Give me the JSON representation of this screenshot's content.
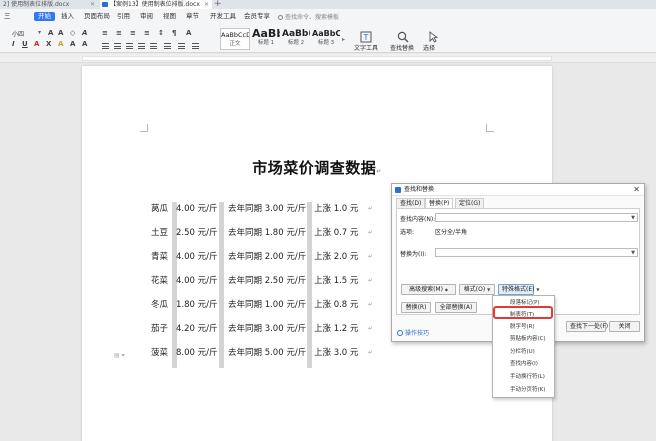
{
  "tabs": [
    {
      "label": "2] 使用制表位排版.docx"
    },
    {
      "label": "【案例13】使用制表位排版.docx"
    }
  ],
  "menu": {
    "items": [
      "三",
      "开始",
      "插入",
      "页面布局",
      "引用",
      "审阅",
      "视图",
      "章节",
      "开发工具",
      "会员专享"
    ],
    "active": "开始",
    "search": "查找命令、搜索模板"
  },
  "ribbon": {
    "font_size": "小四",
    "styles": [
      {
        "sample": "AaBbCcDd",
        "name": "正文"
      },
      {
        "sample": "AaBb",
        "name": "标题 1"
      },
      {
        "sample": "AaBb(",
        "name": "标题 2"
      },
      {
        "sample": "AaBbC",
        "name": "标题 3"
      }
    ],
    "text_tools": "文字工具",
    "find_replace": "查找替换",
    "select": "选择"
  },
  "doc": {
    "title": "市场菜价调查数据",
    "rows": [
      {
        "name": "莴瓜",
        "price": "4.00 元/斤",
        "last": "去年同期 3.00 元/斤",
        "change": "上涨 1.0 元"
      },
      {
        "name": "土豆",
        "price": "2.50 元/斤",
        "last": "去年同期 1.80 元/斤",
        "change": "上涨 0.7 元"
      },
      {
        "name": "青菜",
        "price": "4.00 元/斤",
        "last": "去年同期 2.00 元/斤",
        "change": "上涨 2.0 元"
      },
      {
        "name": "花菜",
        "price": "4.00 元/斤",
        "last": "去年同期 2.50 元/斤",
        "change": "上涨 1.5 元"
      },
      {
        "name": "冬瓜",
        "price": "1.80 元/斤",
        "last": "去年同期 1.00 元/斤",
        "change": "上涨 0.8 元"
      },
      {
        "name": "茄子",
        "price": "4.20 元/斤",
        "last": "去年同期 3.00 元/斤",
        "change": "上涨 1.2 元"
      },
      {
        "name": "菠菜",
        "price": "8.00 元/斤",
        "last": "去年同期 5.00 元/斤",
        "change": "上涨 3.0 元"
      }
    ]
  },
  "dialog": {
    "title": "查找和替换",
    "tabs": [
      "查找(D)",
      "替换(P)",
      "定位(G)"
    ],
    "active_tab": "替换(P)",
    "find_label": "查找内容(N):",
    "find_value": "",
    "options_label": "选项:",
    "options_value": "区分全/半角",
    "replace_label": "替换为(I):",
    "replace_value": "",
    "btn_advanced": "高级搜索(M)",
    "btn_format": "格式(O)",
    "btn_special": "特殊格式(E)",
    "btn_replace": "替换(R)",
    "btn_replace_all": "全部替换(A)",
    "btn_find_next": "查找下一处(F)",
    "btn_close": "关闭",
    "tip": "操作技巧"
  },
  "special_menu": {
    "items": [
      "段落标记(P)",
      "制表符(T)",
      "脱字号(R)",
      "剪贴板内容(C)",
      "分栏符(U)",
      "查找内容(I)",
      "手动换行符(L)",
      "手动分页符(K)"
    ],
    "highlighted": "制表符(T)"
  },
  "colors": {
    "accent": "#3377ee",
    "highlight": "#e53935"
  }
}
